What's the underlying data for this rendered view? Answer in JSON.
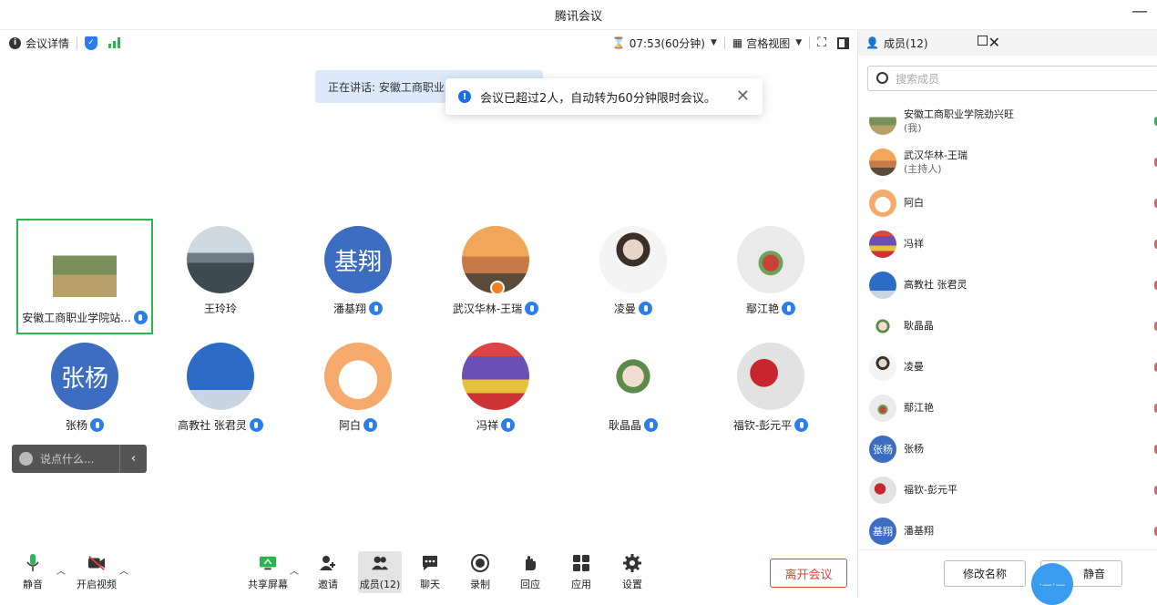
{
  "window": {
    "title": "腾讯会议"
  },
  "topbar": {
    "meeting_details": "会议详情",
    "timer": "07:53(60分钟)",
    "view_mode": "宫格视图"
  },
  "banner": {
    "speaking": "正在讲话: 安徽工商职业"
  },
  "toast": {
    "message": "会议已超过2人，自动转为60分钟限时会议。"
  },
  "grid": {
    "tiles": [
      {
        "name": "安徽工商职业学院站...",
        "avatar": "photo-field",
        "active": true
      },
      {
        "name": "王玲玲",
        "avatar": "photo-lake"
      },
      {
        "name": "潘基翔",
        "avatar_text": "基翔"
      },
      {
        "name": "武汉华林-王瑞",
        "avatar": "photo-sunset",
        "host": true
      },
      {
        "name": "凌曼",
        "avatar": "photo-person"
      },
      {
        "name": "鄢江艳",
        "avatar": "photo-toy"
      },
      {
        "name": "张杨",
        "avatar_text": "张杨"
      },
      {
        "name": "高教社 张君灵",
        "avatar": "photo-sky"
      },
      {
        "name": "阿白",
        "avatar": "cartoon-dog"
      },
      {
        "name": "冯祥",
        "avatar": "photo-flowers"
      },
      {
        "name": "耿晶晶",
        "avatar": "cartoon-bunny"
      },
      {
        "name": "福钦-彭元平",
        "avatar": "photo-umbrella"
      }
    ]
  },
  "chat_input": {
    "placeholder": "说点什么..."
  },
  "sidebar": {
    "title": "成员(12)",
    "search_placeholder": "搜索成员",
    "members": [
      {
        "name": "安徽工商职业学院劲兴旺",
        "sub": "(我)"
      },
      {
        "name": "武汉华林-王瑞",
        "sub": "(主持人)"
      },
      {
        "name": "阿白",
        "sub": ""
      },
      {
        "name": "冯祥",
        "sub": ""
      },
      {
        "name": "高教社 张君灵",
        "sub": ""
      },
      {
        "name": "耿晶晶",
        "sub": ""
      },
      {
        "name": "凌曼",
        "sub": ""
      },
      {
        "name": "鄢江艳",
        "sub": ""
      },
      {
        "name": "张杨",
        "sub": "",
        "avatar_text": "张杨"
      },
      {
        "name": "福钦-彭元平",
        "sub": ""
      },
      {
        "name": "潘基翔",
        "sub": "",
        "avatar_text": "基翔"
      }
    ],
    "rename_button": "修改名称",
    "mute_button": "静音"
  },
  "toolbar": {
    "mute": "静音",
    "video": "开启视频",
    "share": "共享屏幕",
    "invite": "邀请",
    "members": "成员(12)",
    "chat": "聊天",
    "record": "录制",
    "react": "回应",
    "apps": "应用",
    "settings": "设置",
    "leave": "离开会议"
  },
  "colors": {
    "accent": "#2b7de9",
    "active_green": "#2db552",
    "danger": "#e3413a",
    "avatar_blue": "#3c6dc0"
  }
}
